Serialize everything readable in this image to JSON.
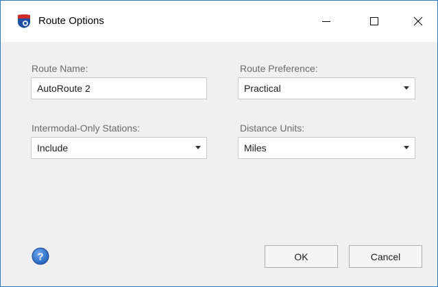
{
  "window": {
    "title": "Route Options",
    "app_icon": "interstate-shield-icon",
    "controls": [
      "minimize-icon",
      "maximize-icon",
      "close-icon"
    ]
  },
  "form": {
    "route_name": {
      "label": "Route Name:",
      "value": "AutoRoute 2"
    },
    "route_preference": {
      "label": "Route Preference:",
      "value": "Practical"
    },
    "intermodal_only_stations": {
      "label": "Intermodal-Only Stations:",
      "value": "Include"
    },
    "distance_units": {
      "label": "Distance Units:",
      "value": "Miles"
    }
  },
  "footer": {
    "help_icon": "question-mark-icon",
    "ok_label": "OK",
    "cancel_label": "Cancel"
  },
  "colors": {
    "window_border": "#2b79c2",
    "help_blue": "#1f5fb8",
    "shield_red": "#d12b2b",
    "shield_blue": "#1e4fa3"
  }
}
